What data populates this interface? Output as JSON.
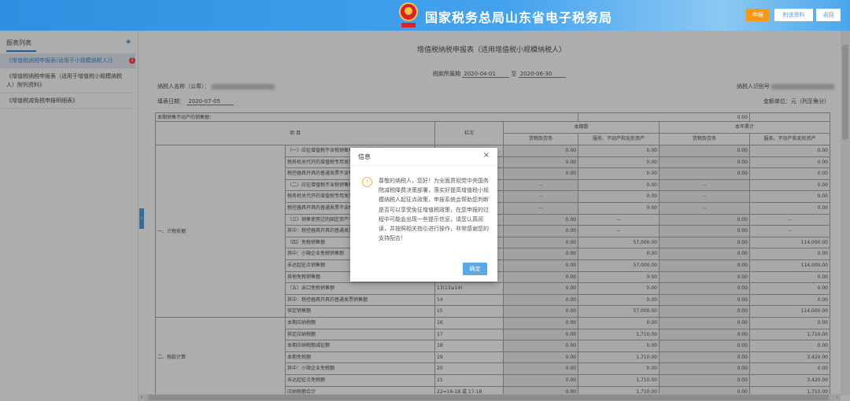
{
  "header": {
    "title": "国家税务总局山东省电子税务局",
    "emblem_text": "中国税务",
    "buttons": [
      "申报",
      "附送资料",
      "返回"
    ]
  },
  "sidebar": {
    "title": "报表列表",
    "badge": "2",
    "items": [
      {
        "label": "《增值税纳税申报表(适用于小规模纳税人)》",
        "active": true
      },
      {
        "label": "《增值税纳税申报表（适用于增值税小规模纳税人）附列资料》"
      },
      {
        "label": "《增值税减免税申报明细表》"
      }
    ]
  },
  "form": {
    "title": "增值税纳税申报表（适用增值税小规模纳税人）",
    "period_label": "税款所属期",
    "period_from": "2020-04-01",
    "period_to_label": "至",
    "period_to": "2020-06-30",
    "taxpayer_name_label": "纳税人名称（公章）：",
    "taxpayer_id_label": "纳税人识别号",
    "fill_date_label": "填表日期：",
    "fill_date": "2020-07-05",
    "unit_label": "金额单位：元（列至角分）",
    "realestate_label": "本期销售不动产的销售额：",
    "realestate_value": "0.00"
  },
  "table": {
    "col_item": "项  目",
    "col_line": "栏次",
    "group_current": "本期数",
    "group_year": "本年累计",
    "sub_goods": "货物及劳务",
    "sub_services": "服务、不动产和无形资产",
    "categories": [
      "一、计税依据",
      "二、税款计算"
    ],
    "rows": [
      {
        "label": "（一）应征增值税不含税销售额（3%征收率）",
        "line": "1",
        "v": [
          "0.00",
          "0.00",
          "0.00",
          "0.00"
        ]
      },
      {
        "label": "税务机关代开的增值税专用发票不含税销售额",
        "line": "2",
        "v": [
          "0.00",
          "0.00",
          "0.00",
          "0.00"
        ]
      },
      {
        "label": "税控器具开具的普通发票不含税销售额",
        "line": "3",
        "v": [
          "0.00",
          "0.00",
          "0.00",
          "0.00"
        ]
      },
      {
        "label": "（二）应征增值税不含税销售额（5%征收率）",
        "line": "4",
        "v": [
          "--",
          "0.00",
          "--",
          "0.00"
        ]
      },
      {
        "label": "税务机关代开的增值税专用发票不含税销售额",
        "line": "5",
        "v": [
          "--",
          "0.00",
          "--",
          "0.00"
        ]
      },
      {
        "label": "税控器具开具的普通发票不含税销售额",
        "line": "6",
        "v": [
          "--",
          "0.00",
          "--",
          "0.00"
        ]
      },
      {
        "label": "（三）销售使用过的固定资产不含税销售额",
        "line": "7",
        "v": [
          "0.00",
          "--",
          "0.00",
          "--"
        ]
      },
      {
        "label": "其中：税控器具开具的普通发票不含税销售额",
        "line": "8",
        "v": [
          "0.00",
          "--",
          "0.00",
          "--"
        ]
      },
      {
        "label": "（四）免税销售额",
        "line": "9",
        "v": [
          "0.00",
          "57,000.00",
          "0.00",
          "114,000.00"
        ]
      },
      {
        "label": "其中：小微企业免税销售额",
        "line": "10",
        "v": [
          "0.00",
          "0.00",
          "0.00",
          "0.00"
        ]
      },
      {
        "label": "未达起征点销售额",
        "line": "11",
        "v": [
          "0.00",
          "57,000.00",
          "0.00",
          "114,000.00"
        ]
      },
      {
        "label": "其他免税销售额",
        "line": "12",
        "v": [
          "0.00",
          "0.00",
          "0.00",
          "0.00"
        ]
      },
      {
        "label": "（五）出口免税销售额",
        "line": "13(13≥14)",
        "v": [
          "0.00",
          "0.00",
          "0.00",
          "0.00"
        ]
      },
      {
        "label": "其中：税控器具开具的普通发票销售额",
        "line": "14",
        "v": [
          "0.00",
          "0.00",
          "0.00",
          "0.00"
        ]
      },
      {
        "label": "核定销售额",
        "line": "15",
        "v": [
          "0.00",
          "57,000.00",
          "0.00",
          "114,000.00"
        ]
      },
      {
        "label": "本期应纳税额",
        "line": "16",
        "v": [
          "0.00",
          "0.00",
          "0.00",
          "0.00"
        ]
      },
      {
        "label": "核定应纳税额",
        "line": "17",
        "v": [
          "0.00",
          "1,710.00",
          "0.00",
          "1,710.00"
        ]
      },
      {
        "label": "本期应纳税额减征额",
        "line": "18",
        "v": [
          "0.00",
          "0.00",
          "0.00",
          "0.00"
        ]
      },
      {
        "label": "本期免税额",
        "line": "19",
        "v": [
          "0.00",
          "1,710.00",
          "0.00",
          "3,420.00"
        ]
      },
      {
        "label": "其中：小微企业免税额",
        "line": "20",
        "v": [
          "0.00",
          "0.00",
          "0.00",
          "0.00"
        ]
      },
      {
        "label": "未达起征点免税额",
        "line": "21",
        "v": [
          "0.00",
          "1,710.00",
          "0.00",
          "3,420.00"
        ]
      },
      {
        "label": "应纳税额合计",
        "line": "22=16-18 或 17-18",
        "v": [
          "0.00",
          "1,710.00",
          "0.00",
          "1,710.00"
        ]
      }
    ]
  },
  "dialog": {
    "title": "信息",
    "close": "×",
    "icon": "warning-icon",
    "message": "尊敬的纳税人，您好！为全面贯彻党中央国务院减税降费决策部署，落实好提高增值税小规模纳税人起征点政策，申报系统会帮助您判断是否可以享受免征增值税政策，在您申报的过程中可能会出现一些提示信息，请您认真阅读，并按照相关指引进行操作，非常感谢您的支持配合！",
    "ok": "确定"
  },
  "colors": {
    "header": "#2f8fe0",
    "primary_button": "#f59a16",
    "dialog_button": "#5aa9e6",
    "badge": "#e22233"
  }
}
